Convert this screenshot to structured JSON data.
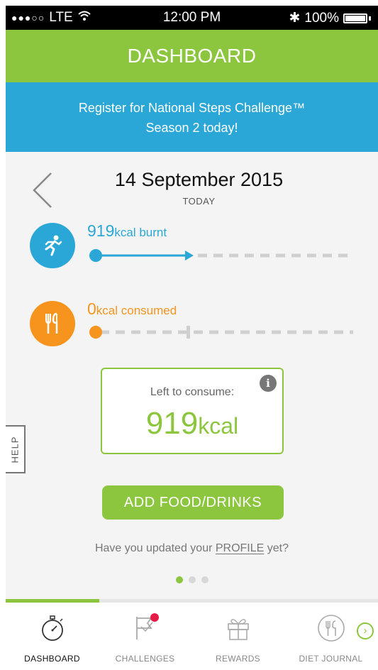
{
  "status_bar": {
    "signal": "●●●○○",
    "carrier": "LTE",
    "wifi_icon": "wifi-icon",
    "time": "12:00 PM",
    "bluetooth": "✱",
    "battery": "100%"
  },
  "header": {
    "title": "DASHBOARD"
  },
  "banner": {
    "line1": "Register for National Steps Challenge™",
    "line2": "Season 2 today!"
  },
  "date": {
    "value": "14 September 2015",
    "sub": "TODAY"
  },
  "burnt": {
    "value": "919",
    "unit": "kcal burnt",
    "progress": 0.38
  },
  "consumed": {
    "value": "0",
    "unit": "kcal consumed",
    "progress": 0.0
  },
  "left_box": {
    "label": "Left to consume:",
    "value": "919",
    "unit": "kcal",
    "info": "i"
  },
  "help": {
    "label": "HELP"
  },
  "add_button": {
    "label": "ADD FOOD/DRINKS"
  },
  "profile_prompt": {
    "before": "Have you updated your ",
    "link": "PROFILE",
    "after": " yet?"
  },
  "pager": {
    "count": 3,
    "active": 0
  },
  "tabs": [
    {
      "label": "DASHBOARD",
      "icon": "stopwatch-icon",
      "active": true
    },
    {
      "label": "CHALLENGES",
      "icon": "flag-icon",
      "active": false,
      "badge": true
    },
    {
      "label": "REWARDS",
      "icon": "gift-icon",
      "active": false
    },
    {
      "label": "DIET JOURNAL",
      "icon": "fork-knife-icon",
      "active": false
    }
  ],
  "colors": {
    "green": "#8cc63f",
    "blue": "#2aa7d6",
    "orange": "#f7941d"
  }
}
